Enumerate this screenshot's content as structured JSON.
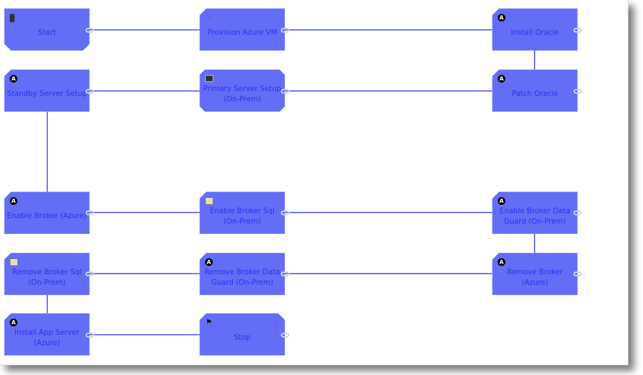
{
  "colors": {
    "node_fill": "#636df5",
    "node_text": "#2a32ea",
    "wire": "#6f78f5"
  },
  "nodes": [
    {
      "id": "start",
      "label": "Start",
      "icon": "traffic-light-icon"
    },
    {
      "id": "provision",
      "label": "Provision Azure VM",
      "icon": "azure-vm-icon"
    },
    {
      "id": "install-oracle",
      "label": "Install Oracle",
      "icon": "ansible-icon"
    },
    {
      "id": "standby",
      "label": "Standby Server Setup",
      "icon": "ansible-icon"
    },
    {
      "id": "primary",
      "label": "Primary Server Setup (On-Prem)",
      "icon": "terminal-icon"
    },
    {
      "id": "patch-oracle",
      "label": "Patch Oracle",
      "icon": "ansible-icon"
    },
    {
      "id": "enable-broker-azure",
      "label": "Enable Broker (Azure)",
      "icon": "ansible-icon"
    },
    {
      "id": "enable-broker-sql",
      "label": "Enable Broker Sql (On-Prem)",
      "icon": "script-icon"
    },
    {
      "id": "enable-broker-dg",
      "label": "Enable Broker Data Guard (On-Prem)",
      "icon": "ansible-icon"
    },
    {
      "id": "remove-broker-sql",
      "label": "Remove Broker Sql (On-Prem)",
      "icon": "script-icon"
    },
    {
      "id": "remove-broker-dg",
      "label": "Remove Broker Data Guard (On-Prem)",
      "icon": "ansible-icon"
    },
    {
      "id": "remove-broker-azure",
      "label": "Remove Broker (Azure)",
      "icon": "ansible-icon"
    },
    {
      "id": "install-app",
      "label": "Install App Server (Azure)",
      "icon": "ansible-icon"
    },
    {
      "id": "stop",
      "label": "Stop",
      "icon": "checkered-flag-icon"
    }
  ]
}
